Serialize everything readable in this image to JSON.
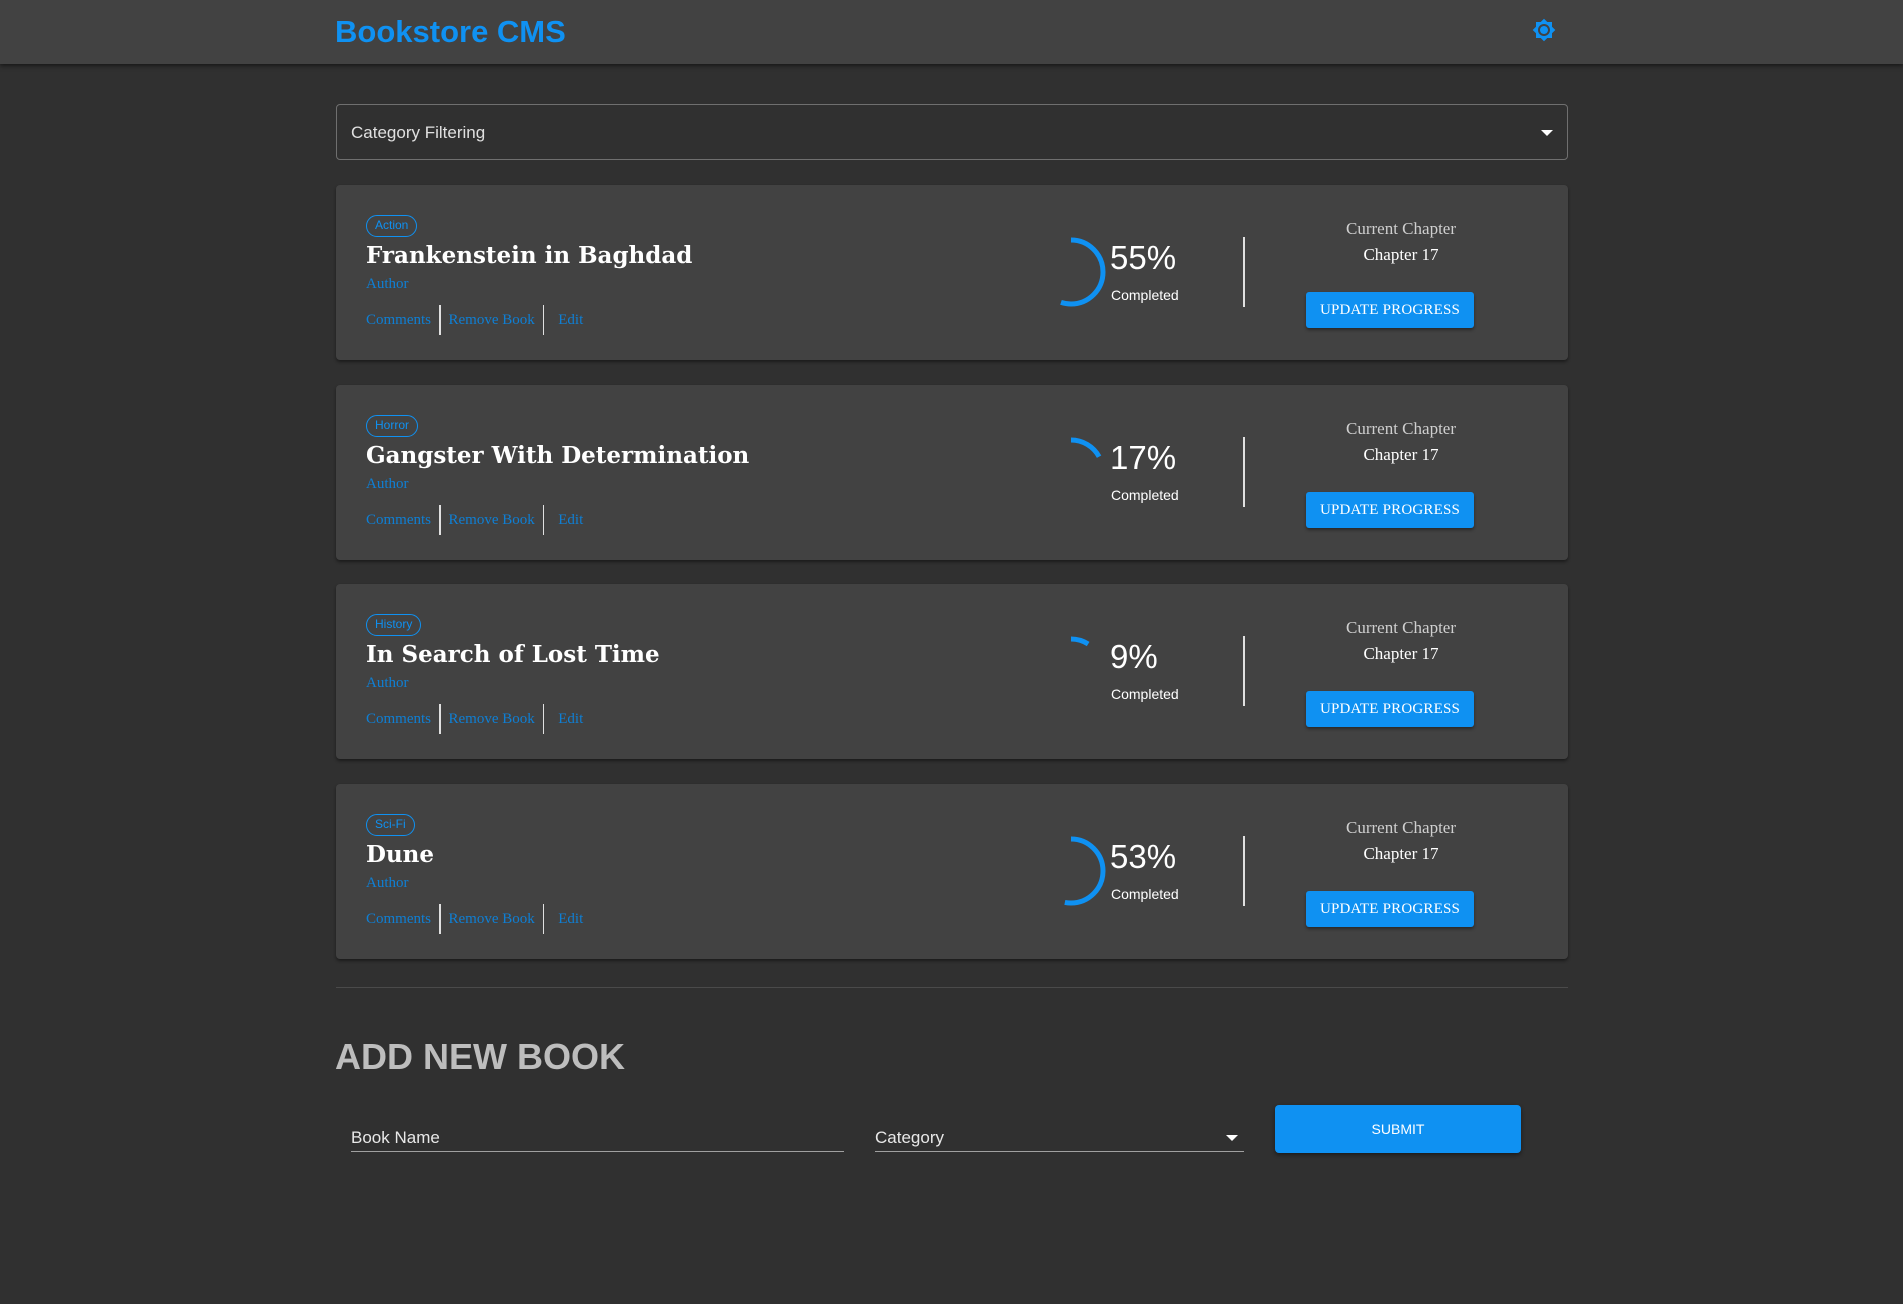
{
  "app": {
    "title": "Bookstore CMS",
    "accent_color": "#0f91f2",
    "theme_icon": "brightness-settings-icon"
  },
  "filter": {
    "label": "Category Filtering"
  },
  "books": [
    {
      "category": "Action",
      "title": "Frankenstein in Baghdad",
      "author": "Author",
      "actions": [
        "Comments",
        "Remove Book",
        "Edit"
      ],
      "progress_percent": 55,
      "percent_label": "55%",
      "completed_label": "Completed",
      "current_chapter_label": "Current Chapter",
      "current_chapter": "Chapter 17",
      "update_label": "UPDATE PROGRESS"
    },
    {
      "category": "Horror",
      "title": "Gangster With Determination",
      "author": "Author",
      "actions": [
        "Comments",
        "Remove Book",
        "Edit"
      ],
      "progress_percent": 17,
      "percent_label": "17%",
      "completed_label": "Completed",
      "current_chapter_label": "Current Chapter",
      "current_chapter": "Chapter 17",
      "update_label": "UPDATE PROGRESS"
    },
    {
      "category": "History",
      "title": "In Search of Lost Time",
      "author": "Author",
      "actions": [
        "Comments",
        "Remove Book",
        "Edit"
      ],
      "progress_percent": 9,
      "percent_label": "9%",
      "completed_label": "Completed",
      "current_chapter_label": "Current Chapter",
      "current_chapter": "Chapter 17",
      "update_label": "UPDATE PROGRESS"
    },
    {
      "category": "Sci-Fi",
      "title": "Dune",
      "author": "Author",
      "actions": [
        "Comments",
        "Remove Book",
        "Edit"
      ],
      "progress_percent": 53,
      "percent_label": "53%",
      "completed_label": "Completed",
      "current_chapter_label": "Current Chapter",
      "current_chapter": "Chapter 17",
      "update_label": "UPDATE PROGRESS"
    }
  ],
  "add_book": {
    "title": "ADD NEW BOOK",
    "book_name_label": "Book Name",
    "category_label": "Category",
    "submit_label": "SUBMIT"
  }
}
